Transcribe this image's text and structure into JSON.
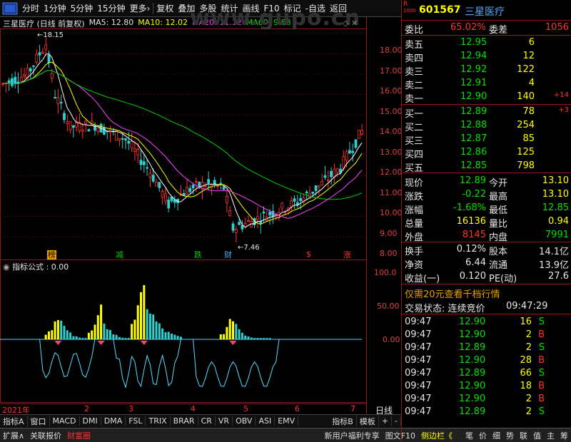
{
  "toolbar": {
    "items": [
      "分时",
      "1分钟",
      "5分钟",
      "15分钟",
      "更多›",
      "复权",
      "叠加",
      "多股",
      "统计",
      "画线",
      "F10",
      "标记",
      "-自选",
      "返回"
    ]
  },
  "chart": {
    "title": "三星医疗 (日线 前复权)",
    "ma5": "MA5: 12.80",
    "ma10": "MA10: 12.02",
    "ma20": "MA20: 11.12",
    "ma60": "MA60: 9.88",
    "watermark": "www.gupo.cn",
    "high_label": "18.15",
    "low_label": "7.46",
    "y_ticks": [
      "18.00",
      "17.00",
      "16.00",
      "15.00",
      "14.00",
      "13.00",
      "12.00",
      "11.00",
      "10.00",
      "9.00",
      "8.00"
    ],
    "markers": [
      {
        "text": "榜",
        "color": "#e8a000"
      },
      {
        "text": "减",
        "color": "#00cc00"
      },
      {
        "text": "跌",
        "color": "#00cc00"
      },
      {
        "text": "财",
        "color": "#44aaff"
      },
      {
        "text": "$",
        "color": "#ff3030"
      },
      {
        "text": "涨",
        "color": "#ff3030"
      }
    ]
  },
  "indicator": {
    "title": "指标公式",
    "value": ": 0.00",
    "y_ticks": [
      "100.0",
      "50.00",
      "0.00"
    ]
  },
  "x_axis": {
    "year": "2021年",
    "months": [
      "2",
      "3",
      "4",
      "5",
      "6",
      "7"
    ],
    "right_label": "日线"
  },
  "tabs": [
    "指标A",
    "窗口",
    "MACD",
    "DMI",
    "DMA",
    "FSL",
    "TRIX",
    "BRAR",
    "CR",
    "VR",
    "OBV",
    "ASI",
    "EMV",
    "指标B",
    "模板",
    "+",
    "-"
  ],
  "status": {
    "left": [
      "扩展∧",
      "关联报价",
      "财富圈"
    ],
    "mid": [
      "新用户福利专享",
      "图文F10",
      "侧边栏《"
    ],
    "right": [
      "笔",
      "价",
      "细",
      "势",
      "联",
      "值",
      "主",
      "筹"
    ]
  },
  "panel": {
    "code": "601567",
    "name": "三星医疗",
    "badge": "R",
    "badge_sub": "1000",
    "weibi_label": "委比",
    "weibi": "65.02%",
    "weicha_label": "委差",
    "weicha": "1056",
    "sells": [
      {
        "label": "卖五",
        "price": "12.95",
        "vol": "6",
        "chg": ""
      },
      {
        "label": "卖四",
        "price": "12.94",
        "vol": "12",
        "chg": ""
      },
      {
        "label": "卖三",
        "price": "12.92",
        "vol": "122",
        "chg": ""
      },
      {
        "label": "卖二",
        "price": "12.91",
        "vol": "4",
        "chg": ""
      },
      {
        "label": "卖一",
        "price": "12.90",
        "vol": "140",
        "chg": "+14"
      }
    ],
    "buys": [
      {
        "label": "买一",
        "price": "12.89",
        "vol": "78",
        "chg": "+3"
      },
      {
        "label": "买二",
        "price": "12.88",
        "vol": "254",
        "chg": ""
      },
      {
        "label": "买三",
        "price": "12.87",
        "vol": "85",
        "chg": ""
      },
      {
        "label": "买四",
        "price": "12.86",
        "vol": "125",
        "chg": ""
      },
      {
        "label": "买五",
        "price": "12.85",
        "vol": "798",
        "chg": ""
      }
    ],
    "quote": [
      {
        "l1": "现价",
        "v1": "12.89",
        "c1": "green",
        "l2": "今开",
        "v2": "13.10",
        "c2": "yellow"
      },
      {
        "l1": "涨跌",
        "v1": "-0.22",
        "c1": "green",
        "l2": "最高",
        "v2": "13.10",
        "c2": "yellow"
      },
      {
        "l1": "涨幅",
        "v1": "-1.68%",
        "c1": "green",
        "l2": "最低",
        "v2": "12.85",
        "c2": "green"
      },
      {
        "l1": "总量",
        "v1": "16136",
        "c1": "yellow",
        "l2": "量比",
        "v2": "0.94",
        "c2": "yellow"
      },
      {
        "l1": "外盘",
        "v1": "8145",
        "c1": "red",
        "l2": "内盘",
        "v2": "7991",
        "c2": "green"
      }
    ],
    "fin": [
      {
        "l1": "换手",
        "v1": "0.12%",
        "l2": "股本",
        "v2": "14.1亿"
      },
      {
        "l1": "净资",
        "v1": "6.44",
        "l2": "流通",
        "v2": "13.9亿"
      },
      {
        "l1": "收益(一)",
        "v1": "0.120",
        "l2": "PE(动)",
        "v2": "27.6"
      }
    ],
    "promo": "仅需20元查看千档行情",
    "trade_status_label": "交易状态: 连续竞价",
    "trade_time": "09:47:29",
    "ticks": [
      {
        "time": "09:47",
        "price": "12.90",
        "vol": "16",
        "side": "S"
      },
      {
        "time": "09:47",
        "price": "12.90",
        "vol": "2",
        "side": "B"
      },
      {
        "time": "09:47",
        "price": "12.89",
        "vol": "2",
        "side": "S"
      },
      {
        "time": "09:47",
        "price": "12.90",
        "vol": "28",
        "side": "B"
      },
      {
        "time": "09:47",
        "price": "12.89",
        "vol": "66",
        "side": "S"
      },
      {
        "time": "09:47",
        "price": "12.90",
        "vol": "18",
        "side": "B"
      },
      {
        "time": "09:47",
        "price": "12.90",
        "vol": "2",
        "side": "B"
      },
      {
        "time": "09:47",
        "price": "12.89",
        "vol": "2",
        "side": "S"
      }
    ]
  },
  "colors": {
    "up": "#ff3030",
    "down": "#00e000",
    "ma5": "#ffffff",
    "ma10": "#ffff00",
    "ma20": "#ff40ff",
    "ma60": "#00cc00",
    "frame": "#8b1a1a"
  }
}
